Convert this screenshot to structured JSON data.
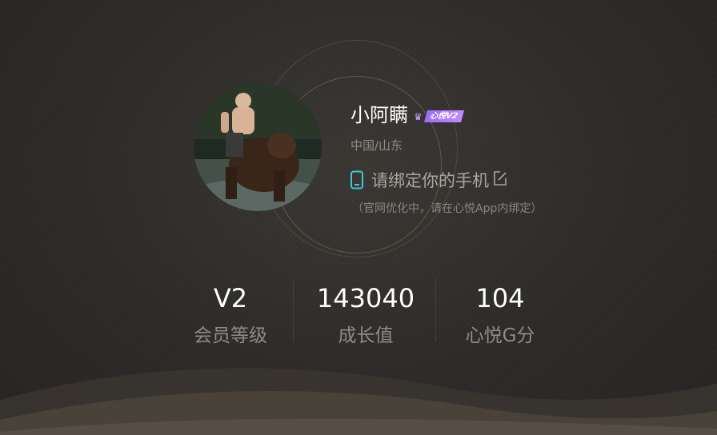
{
  "profile": {
    "username": "小阿瞒",
    "vip_badge": "心悦V2",
    "location": "中国/山东",
    "bind_phone_text": "请绑定你的手机",
    "bind_note": "（官网优化中，请在心悦App内绑定）"
  },
  "stats": [
    {
      "value": "V2",
      "label": "会员等级"
    },
    {
      "value": "143040",
      "label": "成长值"
    },
    {
      "value": "104",
      "label": "心悦G分"
    }
  ],
  "icons": {
    "phone": "phone-icon",
    "edit": "edit-icon",
    "vip": "crown-icon"
  },
  "colors": {
    "background": "#2b2a28",
    "vip_purple": "#a77bff",
    "phone_cyan": "#3ec9d6",
    "muted_text": "#8f8b86"
  }
}
